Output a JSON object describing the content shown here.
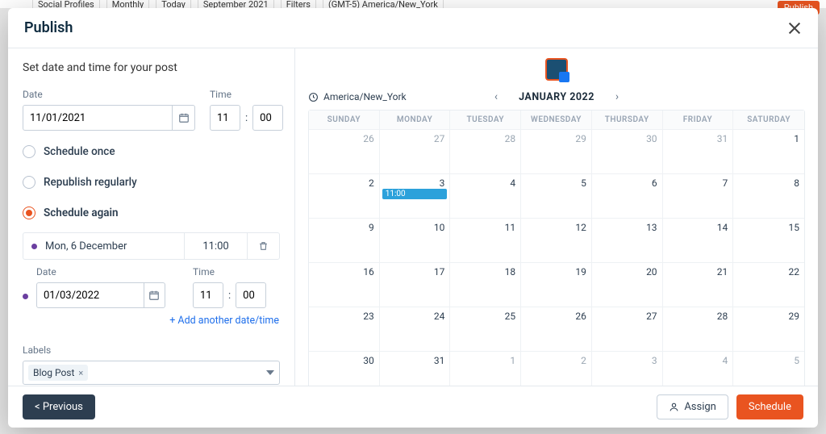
{
  "backdrop": {
    "social": "Social Profiles",
    "view": "Monthly",
    "today": "Today",
    "period": "September 2021",
    "filters": "Filters",
    "tz": "(GMT-5) America/New_York",
    "publish": "Publish"
  },
  "modal": {
    "title": "Publish",
    "instruction": "Set date and time for your post",
    "date_label": "Date",
    "time_label": "Time",
    "date_value": "11/01/2021",
    "hour_value": "11",
    "min_value": "00",
    "radios": {
      "once": "Schedule once",
      "regularly": "Republish regularly",
      "again": "Schedule again"
    },
    "scheduled_entry": {
      "name": "Mon, 6 December",
      "time": "11:00"
    },
    "second_date": {
      "date_label": "Date",
      "time_label": "Time",
      "date_value": "01/03/2022",
      "hour_value": "11",
      "min_value": "00"
    },
    "add_link": "+ Add another date/time",
    "labels_label": "Labels",
    "chip": "Blog Post",
    "chip_x": "×"
  },
  "calendar": {
    "tz": "America/New_York",
    "title": "JANUARY 2022",
    "weekdays": [
      "SUNDAY",
      "MONDAY",
      "TUESDAY",
      "WEDNESDAY",
      "THURSDAY",
      "FRIDAY",
      "SATURDAY"
    ],
    "event_label": "11:00",
    "weeks": [
      [
        {
          "n": 26
        },
        {
          "n": 27
        },
        {
          "n": 28
        },
        {
          "n": 29
        },
        {
          "n": 30
        },
        {
          "n": 31
        },
        {
          "n": 1,
          "in": true
        }
      ],
      [
        {
          "n": 2,
          "in": true
        },
        {
          "n": 3,
          "in": true,
          "ev": true
        },
        {
          "n": 4,
          "in": true
        },
        {
          "n": 5,
          "in": true
        },
        {
          "n": 6,
          "in": true
        },
        {
          "n": 7,
          "in": true
        },
        {
          "n": 8,
          "in": true
        }
      ],
      [
        {
          "n": 9,
          "in": true
        },
        {
          "n": 10,
          "in": true
        },
        {
          "n": 11,
          "in": true
        },
        {
          "n": 12,
          "in": true
        },
        {
          "n": 13,
          "in": true
        },
        {
          "n": 14,
          "in": true
        },
        {
          "n": 15,
          "in": true
        }
      ],
      [
        {
          "n": 16,
          "in": true
        },
        {
          "n": 17,
          "in": true
        },
        {
          "n": 18,
          "in": true
        },
        {
          "n": 19,
          "in": true
        },
        {
          "n": 20,
          "in": true
        },
        {
          "n": 21,
          "in": true
        },
        {
          "n": 22,
          "in": true
        }
      ],
      [
        {
          "n": 23,
          "in": true
        },
        {
          "n": 24,
          "in": true
        },
        {
          "n": 25,
          "in": true
        },
        {
          "n": 26,
          "in": true
        },
        {
          "n": 27,
          "in": true
        },
        {
          "n": 28,
          "in": true
        },
        {
          "n": 29,
          "in": true
        }
      ],
      [
        {
          "n": 30,
          "in": true
        },
        {
          "n": 31,
          "in": true
        },
        {
          "n": 1
        },
        {
          "n": 2
        },
        {
          "n": 3
        },
        {
          "n": 4
        },
        {
          "n": 5
        }
      ]
    ]
  },
  "footer": {
    "previous": "< Previous",
    "assign": "Assign",
    "schedule": "Schedule"
  }
}
